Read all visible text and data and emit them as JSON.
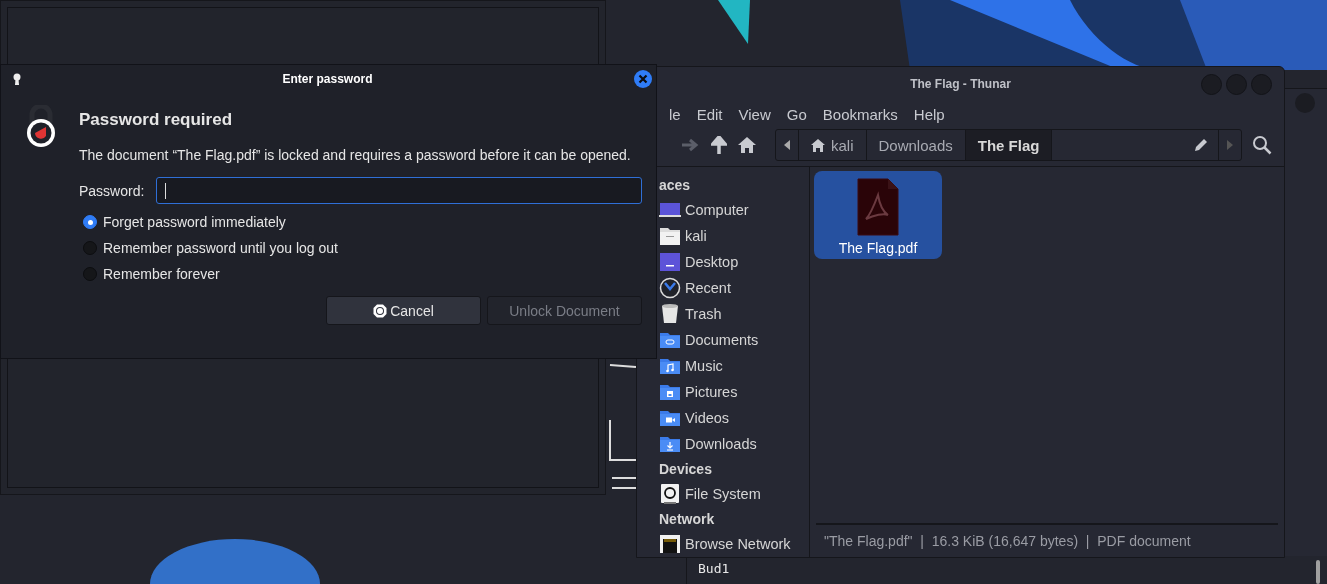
{
  "terminal": {
    "text": "Bud1"
  },
  "dialog": {
    "title": "Enter password",
    "heading": "Password required",
    "message": "The document “The Flag.pdf” is locked and requires a password before it can be opened.",
    "password_label": "Password:",
    "options": [
      {
        "label": "Forget password immediately",
        "selected": true
      },
      {
        "label": "Remember password until you log out",
        "selected": false
      },
      {
        "label": "Remember forever",
        "selected": false
      }
    ],
    "buttons": [
      {
        "label": "Cancel",
        "disabled": false
      },
      {
        "label": "Unlock Document",
        "disabled": true
      }
    ]
  },
  "file_manager": {
    "title": "The Flag - Thunar",
    "menu": [
      "le",
      "Edit",
      "View",
      "Go",
      "Bookmarks",
      "Help"
    ],
    "path": [
      {
        "label": "kali",
        "selected": false
      },
      {
        "label": "Downloads",
        "selected": false
      },
      {
        "label": "The Flag",
        "selected": true
      }
    ],
    "sidebar": [
      {
        "heading": "aces",
        "items": [
          {
            "label": "Computer",
            "kind": "computer"
          },
          {
            "label": "kali",
            "kind": "home"
          },
          {
            "label": "Desktop",
            "kind": "desktop"
          },
          {
            "label": "Recent",
            "kind": "recent"
          },
          {
            "label": "Trash",
            "kind": "trash"
          },
          {
            "label": "Documents",
            "kind": "documents"
          },
          {
            "label": "Music",
            "kind": "music"
          },
          {
            "label": "Pictures",
            "kind": "pictures"
          },
          {
            "label": "Videos",
            "kind": "videos"
          },
          {
            "label": "Downloads",
            "kind": "downloads"
          }
        ]
      },
      {
        "heading": "Devices",
        "items": [
          {
            "label": "File System",
            "kind": "drive"
          }
        ]
      },
      {
        "heading": "Network",
        "items": [
          {
            "label": "Browse Network",
            "kind": "network"
          }
        ]
      }
    ],
    "files": [
      {
        "name": "The Flag.pdf",
        "selected": true
      }
    ],
    "status": "\"The Flag.pdf\"  |  16.3 KiB (16,647 bytes)  |  PDF document"
  }
}
